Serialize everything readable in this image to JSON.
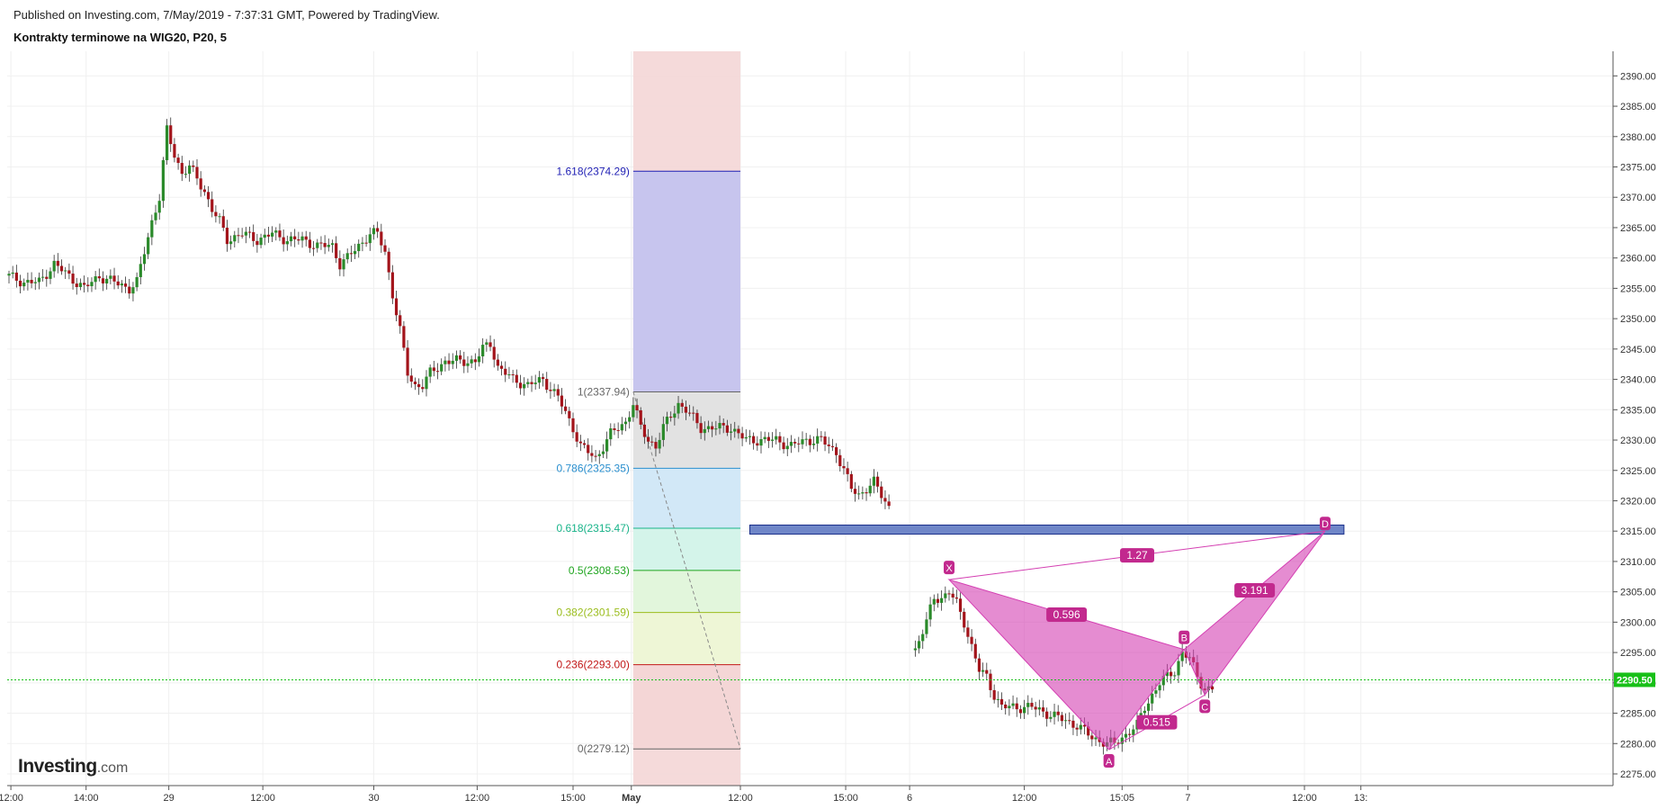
{
  "header": {
    "published": "Published on Investing.com, 7/May/2019 - 7:37:31 GMT, Powered by TradingView.",
    "symbol": "Kontrakty terminowe na WIG20, P20, 5"
  },
  "logo": {
    "main": "Investing",
    "domain": ".com"
  },
  "colors": {
    "up": "#2a8a2a",
    "down": "#a3141b",
    "price_line": "#18c018",
    "pattern": "#d43fb2",
    "zone": "#6f86c8"
  },
  "chart_data": {
    "type": "candlestick",
    "ylim": [
      2272,
      2393
    ],
    "y_ticks": [
      2275,
      2280,
      2285,
      2290,
      2295,
      2300,
      2305,
      2310,
      2315,
      2320,
      2325,
      2330,
      2335,
      2340,
      2345,
      2350,
      2355,
      2360,
      2365,
      2370,
      2375,
      2380,
      2385,
      2390
    ],
    "y_tick_labels": [
      "2275.00",
      "2280.00",
      "2285.00",
      "2290.00",
      "2295.00",
      "2300.00",
      "2305.00",
      "2310.00",
      "2315.00",
      "2320.00",
      "2325.00",
      "2330.00",
      "2335.00",
      "2340.00",
      "2345.00",
      "2350.00",
      "2355.00",
      "2360.00",
      "2365.00",
      "2370.00",
      "2375.00",
      "2380.00",
      "2385.00",
      "2390.00"
    ],
    "x_ticks": [
      {
        "label": "12:00",
        "t": 0.5
      },
      {
        "label": "14:00",
        "t": 20.5
      },
      {
        "label": "29",
        "t": 42.5
      },
      {
        "label": "12:00",
        "t": 67.5
      },
      {
        "label": "30",
        "t": 97
      },
      {
        "label": "12:00",
        "t": 124.5
      },
      {
        "label": "15:00",
        "t": 150
      },
      {
        "label": "May",
        "t": 165.5
      },
      {
        "label": "12:00",
        "t": 194.5
      },
      {
        "label": "15:00",
        "t": 222.5
      },
      {
        "label": "6",
        "t": 239.5
      },
      {
        "label": "12:00",
        "t": 270
      },
      {
        "label": "15:05",
        "t": 296
      },
      {
        "label": "7",
        "t": 313.5
      },
      {
        "label": "12:00",
        "t": 344.5
      },
      {
        "label": "13:",
        "t": 359.5
      }
    ],
    "last_price": 2290.5,
    "last_price_label": "2290.50",
    "series_anchors": [
      [
        0,
        2357
      ],
      [
        4,
        2356
      ],
      [
        8,
        2356
      ],
      [
        12,
        2359
      ],
      [
        16,
        2357
      ],
      [
        20,
        2355
      ],
      [
        24,
        2357
      ],
      [
        28,
        2356
      ],
      [
        32,
        2355
      ],
      [
        34,
        2356
      ],
      [
        36,
        2361
      ],
      [
        38,
        2366
      ],
      [
        40,
        2370
      ],
      [
        42,
        2381
      ],
      [
        44,
        2377
      ],
      [
        46,
        2374
      ],
      [
        48,
        2375
      ],
      [
        50,
        2373
      ],
      [
        52,
        2371
      ],
      [
        54,
        2368
      ],
      [
        56,
        2366
      ],
      [
        58,
        2363
      ],
      [
        62,
        2364
      ],
      [
        66,
        2363
      ],
      [
        70,
        2364
      ],
      [
        74,
        2363
      ],
      [
        78,
        2363
      ],
      [
        82,
        2362
      ],
      [
        86,
        2362
      ],
      [
        88,
        2359
      ],
      [
        90,
        2360
      ],
      [
        93,
        2362
      ],
      [
        96,
        2364
      ],
      [
        98,
        2364
      ],
      [
        100,
        2361
      ],
      [
        102,
        2354
      ],
      [
        104,
        2348
      ],
      [
        106,
        2341
      ],
      [
        108,
        2339
      ],
      [
        110,
        2339
      ],
      [
        112,
        2341
      ],
      [
        116,
        2343
      ],
      [
        120,
        2343
      ],
      [
        124,
        2343
      ],
      [
        126,
        2345
      ],
      [
        128,
        2346
      ],
      [
        130,
        2342
      ],
      [
        134,
        2340
      ],
      [
        138,
        2339
      ],
      [
        142,
        2340
      ],
      [
        146,
        2337
      ],
      [
        150,
        2332
      ],
      [
        152,
        2329
      ],
      [
        156,
        2327
      ],
      [
        160,
        2331
      ],
      [
        164,
        2333
      ],
      [
        166,
        2336
      ],
      [
        168,
        2332
      ],
      [
        170,
        2330
      ],
      [
        172,
        2329
      ],
      [
        174,
        2332
      ],
      [
        176,
        2334
      ],
      [
        178,
        2336
      ],
      [
        180,
        2335
      ],
      [
        184,
        2332
      ],
      [
        188,
        2332
      ],
      [
        192,
        2332
      ],
      [
        196,
        2330
      ],
      [
        200,
        2330
      ],
      [
        204,
        2330
      ],
      [
        208,
        2329
      ],
      [
        212,
        2330
      ],
      [
        216,
        2330
      ],
      [
        218,
        2329
      ],
      [
        220,
        2328
      ],
      [
        222,
        2325
      ],
      [
        224,
        2322
      ],
      [
        226,
        2321
      ],
      [
        230,
        2323
      ],
      [
        232,
        2321
      ],
      [
        234,
        2319
      ],
      [
        240,
        2294
      ],
      [
        242,
        2297
      ],
      [
        244,
        2300
      ],
      [
        246,
        2304
      ],
      [
        248,
        2304
      ],
      [
        250,
        2305
      ],
      [
        252,
        2303
      ],
      [
        254,
        2300
      ],
      [
        256,
        2296
      ],
      [
        258,
        2292
      ],
      [
        260,
        2291
      ],
      [
        262,
        2288
      ],
      [
        264,
        2286
      ],
      [
        268,
        2286
      ],
      [
        272,
        2286
      ],
      [
        276,
        2285
      ],
      [
        280,
        2284
      ],
      [
        284,
        2283
      ],
      [
        288,
        2281
      ],
      [
        292,
        2280
      ],
      [
        294,
        2280
      ],
      [
        296,
        2281
      ],
      [
        300,
        2283
      ],
      [
        302,
        2286
      ],
      [
        304,
        2288
      ],
      [
        306,
        2290
      ],
      [
        308,
        2291
      ],
      [
        310,
        2292
      ],
      [
        312,
        2295
      ],
      [
        314,
        2294
      ],
      [
        316,
        2291
      ],
      [
        318,
        2289
      ],
      [
        320,
        2289
      ]
    ],
    "fibonacci": {
      "levels": [
        {
          "label": "1.618(2374.29)",
          "value": 2374.29,
          "color": "#1f1fb4",
          "fill": "#c7c5ee"
        },
        {
          "label": "1(2337.94)",
          "value": 2337.94,
          "color": "#666666",
          "fill": "#e2e2e2"
        },
        {
          "label": "0.786(2325.35)",
          "value": 2325.35,
          "color": "#2a8fcf",
          "fill": "#d2e8f7"
        },
        {
          "label": "0.618(2315.47)",
          "value": 2315.47,
          "color": "#19b48a",
          "fill": "#d4f4ea"
        },
        {
          "label": "0.5(2308.53)",
          "value": 2308.53,
          "color": "#1fa51f",
          "fill": "#e2f6dc"
        },
        {
          "label": "0.382(2301.59)",
          "value": 2301.59,
          "color": "#9bbd1d",
          "fill": "#eef6d6"
        },
        {
          "label": "0.236(2293.00)",
          "value": 2293.0,
          "color": "#c21818",
          "fill": "#f4d6d6"
        },
        {
          "label": "0(2279.12)",
          "value": 2279.12,
          "color": "#666666",
          "fill": "#f4d6d6"
        }
      ],
      "t_start": 166,
      "t_end": 194.5,
      "background_fill": "#f4d6d6"
    },
    "zone": {
      "t_start": 197,
      "t_end": 355,
      "y_top": 2316,
      "y_bottom": 2314.5
    },
    "harmonic_pattern": {
      "points": [
        {
          "label": "X",
          "t": 250,
          "value": 2307
        },
        {
          "label": "A",
          "t": 292.5,
          "value": 2279
        },
        {
          "label": "B",
          "t": 312.5,
          "value": 2295.5
        },
        {
          "label": "C",
          "t": 318,
          "value": 2288
        },
        {
          "label": "D",
          "t": 350,
          "value": 2315
        }
      ],
      "ratios": [
        {
          "label": "1.27",
          "between": "X-D"
        },
        {
          "label": "0.596",
          "between": "X-B"
        },
        {
          "label": "0.515",
          "between": "A-C"
        },
        {
          "label": "3.191",
          "between": "B-D"
        }
      ]
    }
  }
}
